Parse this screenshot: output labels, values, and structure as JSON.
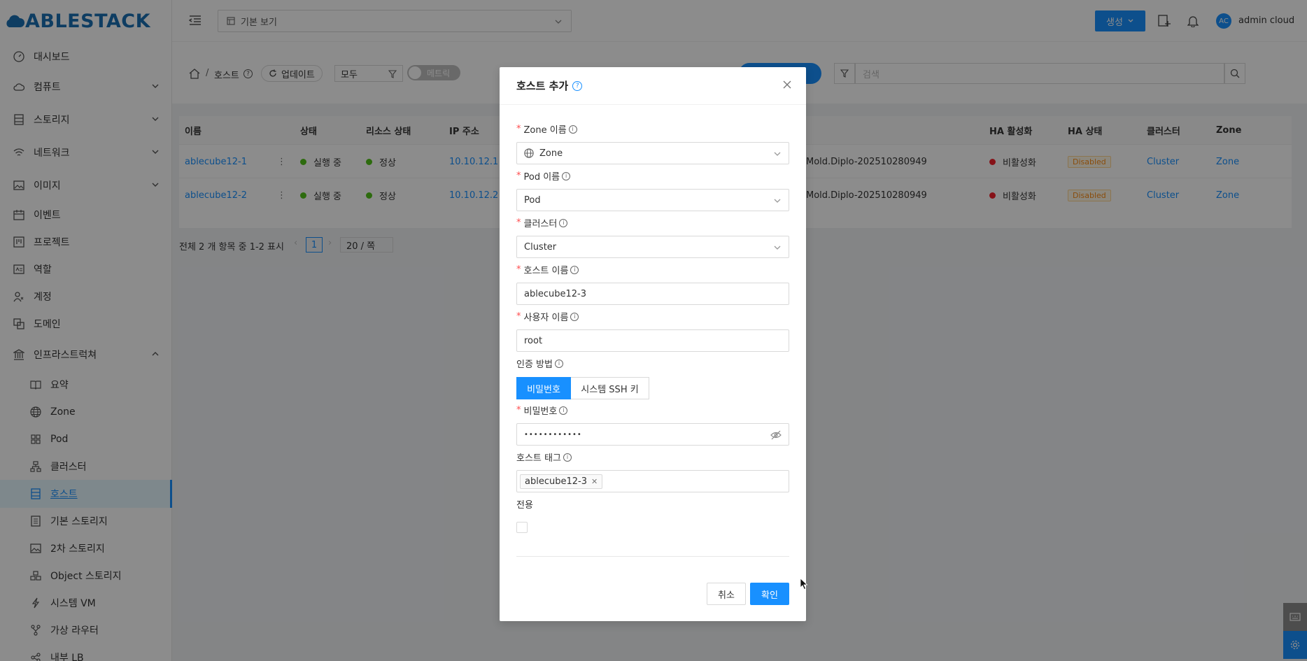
{
  "brand": {
    "logo_text": "ABLESTACK",
    "logo_color": "#1a6fb3"
  },
  "header": {
    "view_select": "기본 보기",
    "create_button": "생성",
    "avatar_initials": "AC",
    "user_name": "admin cloud"
  },
  "sidebar": {
    "items": [
      {
        "label": "대시보드",
        "icon": "dashboard-icon"
      },
      {
        "label": "컴퓨트",
        "icon": "cloud-icon"
      },
      {
        "label": "스토리지",
        "icon": "storage-icon"
      },
      {
        "label": "네트워크",
        "icon": "wifi-icon"
      },
      {
        "label": "이미지",
        "icon": "image-icon"
      },
      {
        "label": "이벤트",
        "icon": "calendar-icon"
      },
      {
        "label": "프로젝트",
        "icon": "project-icon"
      },
      {
        "label": "역할",
        "icon": "idcard-icon"
      },
      {
        "label": "계정",
        "icon": "team-icon"
      },
      {
        "label": "도메인",
        "icon": "block-icon"
      },
      {
        "label": "인프라스트럭쳐",
        "icon": "bank-icon"
      }
    ],
    "sub_items": [
      {
        "label": "요약",
        "icon": "read-icon"
      },
      {
        "label": "Zone",
        "icon": "global-icon"
      },
      {
        "label": "Pod",
        "icon": "appstore-icon"
      },
      {
        "label": "클러스터",
        "icon": "cluster-icon"
      },
      {
        "label": "호스트",
        "icon": "database-icon"
      },
      {
        "label": "기본 스토리지",
        "icon": "hdd-icon"
      },
      {
        "label": "2차 스토리지",
        "icon": "picture-icon"
      },
      {
        "label": "Object 스토리지",
        "icon": "gold-icon"
      },
      {
        "label": "시스템 VM",
        "icon": "thunderbolt-icon"
      },
      {
        "label": "가상 라우터",
        "icon": "fork-icon"
      },
      {
        "label": "내부 LB",
        "icon": "share-icon"
      }
    ]
  },
  "toolbar": {
    "breadcrumb_current": "호스트",
    "breadcrumb_sep": "/",
    "update_button": "업데이트",
    "filter_select": "모두",
    "metrics_toggle": "메트릭",
    "search_placeholder": "검색"
  },
  "table": {
    "headers": [
      "이름",
      "상태",
      "리소스 상태",
      "IP 주소",
      "HA 활성화",
      "HA 상태",
      "클러스터",
      "Zone"
    ],
    "rows": [
      {
        "name": "ablecube12-1",
        "state": "실행 중",
        "resource_state": "정상",
        "ip": "10.10.12.1",
        "version": "Mold.Diplo-202510280949",
        "ha_enabled": "비활성화",
        "ha_state": "Disabled",
        "cluster": "Cluster",
        "zone": "Zone"
      },
      {
        "name": "ablecube12-2",
        "state": "실행 중",
        "resource_state": "정상",
        "ip": "10.10.12.2",
        "version": "Mold.Diplo-202510280949",
        "ha_enabled": "비활성화",
        "ha_state": "Disabled",
        "cluster": "Cluster",
        "zone": "Zone"
      }
    ],
    "pagination_total": "전체 2 개 항목 중 1-2 표시",
    "current_page": "1",
    "page_size": "20 / 쪽"
  },
  "modal": {
    "title": "호스트 추가",
    "fields": {
      "zone_label": "Zone 이름",
      "zone_value": "Zone",
      "pod_label": "Pod 이름",
      "pod_value": "Pod",
      "cluster_label": "클러스터",
      "cluster_value": "Cluster",
      "host_label": "호스트 이름",
      "host_value": "ablecube12-3",
      "user_label": "사용자 이름",
      "user_value": "root",
      "auth_label": "인증 방법",
      "auth_options": [
        "비밀번호",
        "시스템 SSH 키"
      ],
      "auth_selected": "비밀번호",
      "password_label": "비밀번호",
      "password_value": "••••••••••••",
      "tags_label": "호스트 태그",
      "tag_values": [
        "ablecube12-3"
      ],
      "dedicated_label": "전용"
    },
    "cancel_button": "취소",
    "ok_button": "확인"
  }
}
